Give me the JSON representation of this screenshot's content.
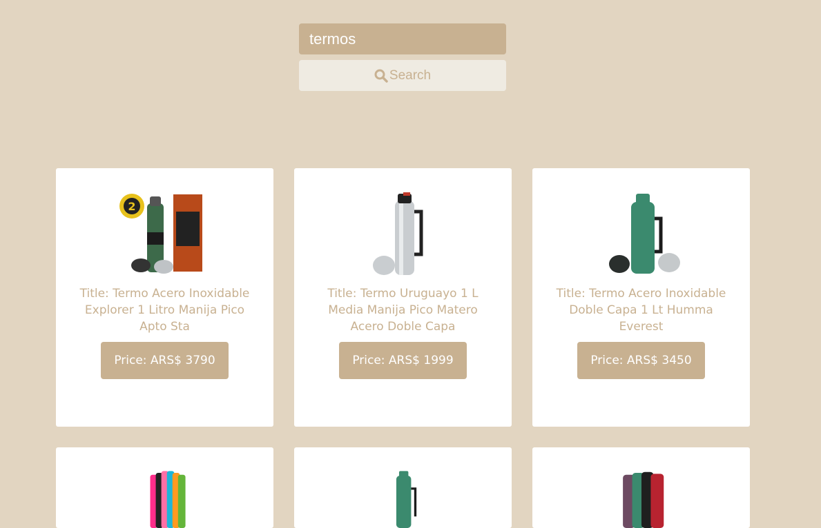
{
  "search": {
    "value": "termos",
    "button_label": "Search"
  },
  "products": [
    {
      "title": "Title: Termo Acero Inoxidable Explorer 1 Litro Manija Pico Apto Sta",
      "price": "Price: ARS$ 3790"
    },
    {
      "title": "Title: Termo Uruguayo 1 L Media Manija Pico Matero Acero Doble Capa",
      "price": "Price: ARS$ 1999"
    },
    {
      "title": "Title: Termo Acero Inoxidable Doble Capa 1 Lt Humma Everest",
      "price": "Price: ARS$ 3450"
    },
    {
      "title": "",
      "price": ""
    },
    {
      "title": "",
      "price": ""
    },
    {
      "title": "",
      "price": ""
    }
  ],
  "colors": {
    "background": "#e2d5c1",
    "accent": "#c8b191",
    "button_bg": "#efebe2",
    "card_bg": "#ffffff"
  }
}
